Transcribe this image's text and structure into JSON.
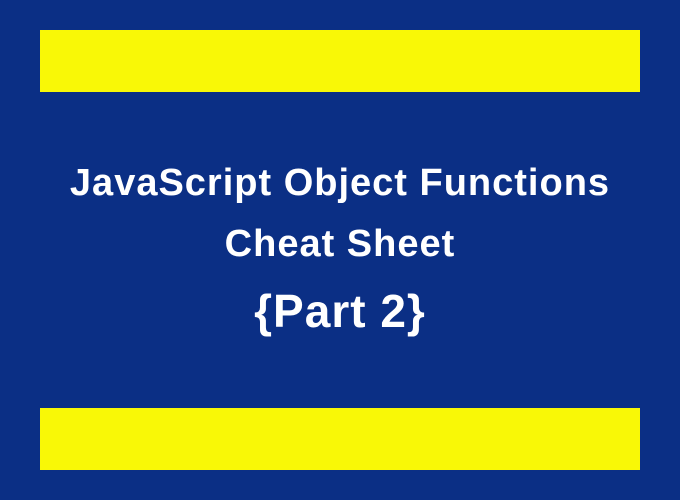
{
  "title": {
    "line1": "JavaScript Object Functions",
    "line2": "Cheat Sheet",
    "part": "{Part 2}"
  },
  "colors": {
    "background": "#0b2f85",
    "accent": "#f9f806",
    "text": "#ffffff"
  }
}
